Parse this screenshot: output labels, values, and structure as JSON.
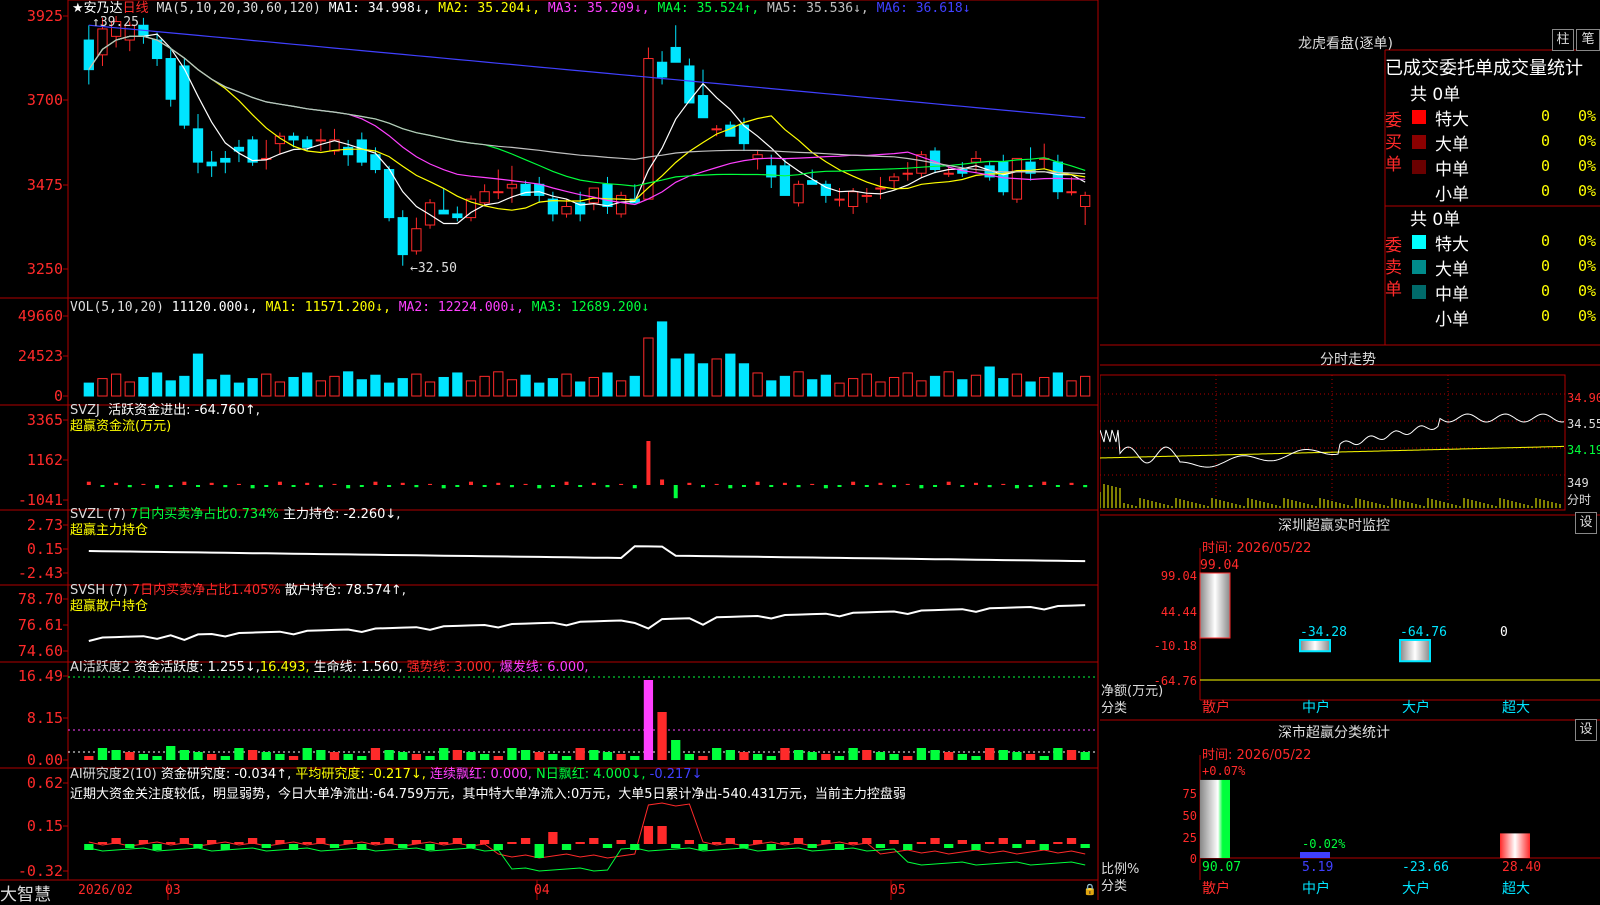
{
  "colors": {
    "up": "#ff2a2a",
    "down": "#00e5ff",
    "grid": "#c00000",
    "border": "#b00000",
    "yellow": "#ffff00",
    "white": "#ffffff",
    "green": "#00ff3c",
    "magenta": "#ff40ff",
    "blue": "#4040ff",
    "gray": "#c0c0c0"
  },
  "main": {
    "title": "★安乃达",
    "period": "日线",
    "ma_label": "MA(5,10,20,30,60,120)",
    "ma1": "MA1: 34.998↓,",
    "ma2": "MA2: 35.204↓,",
    "ma3": "MA3: 35.209↓,",
    "ma4": "MA4: 35.524↑,",
    "ma5": "MA5: 35.536↓,",
    "ma6": "MA6: 36.618↓",
    "high_mark": "39.25",
    "low_mark": "←32.50",
    "yticks": [
      "3925",
      "3700",
      "3475",
      "3250"
    ]
  },
  "vol": {
    "label": "VOL(5,10,20)",
    "val": "11120.000↓,",
    "ma1": "MA1: 11571.200↓,",
    "ma2": "MA2: 12224.000↓,",
    "ma3": "MA3: 12689.200↓",
    "yticks": [
      "49660",
      "24523",
      "0"
    ]
  },
  "svzj": {
    "label": "SVZJ",
    "t1": "活跃资金进出: -64.760↑,",
    "t2": "超赢资金流(万元)",
    "yticks": [
      "3365",
      "1162",
      "-1041"
    ]
  },
  "svzl": {
    "label": "SVZL (7)",
    "t1": "7日内买卖净占比0.734%",
    "t2": "主力持仓: -2.260↓,",
    "t3": "超赢主力持仓",
    "yticks": [
      "2.73",
      "0.15",
      "-2.43"
    ]
  },
  "svsh": {
    "label": "SVSH (7)",
    "t1": "7日内买卖净占比1.405%",
    "t2": "散户持仓: 78.574↑,",
    "t3": "超赢散户持仓",
    "yticks": [
      "78.70",
      "76.61",
      "74.60"
    ]
  },
  "ai1": {
    "label": "AI活跃度2",
    "t1": "资金活跃度: 1.255↓,",
    "t2": "16.493,",
    "t3": "生命线: 1.560,",
    "t4": "强势线: 3.000,",
    "t5": "爆发线: 6.000,",
    "yticks": [
      "16.49",
      "8.15",
      "0.00"
    ]
  },
  "ai2": {
    "label": "AI研究度2(10)",
    "t1": "资金研究度: -0.034↑,",
    "t2": "平均研究度: -0.217↓,",
    "t3": "连续飘红: 0.000,",
    "t4": "N日飘红: 4.000↓,",
    "t5": "-0.217↓",
    "comment": "近期大资金关注度较低，明显弱势，今日大单净流出:-64.759万元，其中特大单净流入:0万元，大单5日累计净出-540.431万元，当前主力控盘弱",
    "yticks": [
      "0.62",
      "0.15",
      "-0.32"
    ]
  },
  "xaxis": {
    "brand": "大智慧",
    "labels": [
      "2026/02",
      "03",
      "04",
      "05"
    ]
  },
  "dragon": {
    "title": "龙虎看盘(逐单)",
    "btn1": "柱",
    "btn2": "笔",
    "subtitle": "已成交委托单成交量统计",
    "buy_label": "委买单",
    "sell_label": "委卖单",
    "buy_total": "共 0单",
    "sell_total": "共 0单",
    "buy_rows": [
      {
        "name": "特大",
        "val": "0",
        "pct": "0%",
        "color": "#ff0000"
      },
      {
        "name": "大单",
        "val": "0",
        "pct": "0%",
        "color": "#8b0000"
      },
      {
        "name": "中单",
        "val": "0",
        "pct": "0%",
        "color": "#6a0000"
      },
      {
        "name": "小单",
        "val": "0",
        "pct": "0%",
        "color": ""
      }
    ],
    "sell_rows": [
      {
        "name": "特大",
        "val": "0",
        "pct": "0%",
        "color": "#00ffff"
      },
      {
        "name": "大单",
        "val": "0",
        "pct": "0%",
        "color": "#008b8b"
      },
      {
        "name": "中单",
        "val": "0",
        "pct": "0%",
        "color": "#006a6a"
      },
      {
        "name": "小单",
        "val": "0",
        "pct": "0%",
        "color": ""
      }
    ]
  },
  "intraday": {
    "title": "分时走势",
    "yticks": [
      "34.90",
      "34.55",
      "34.19"
    ],
    "vol_tick": "349",
    "unit": "分时"
  },
  "sz_monitor": {
    "title": "深圳超赢实时监控",
    "btn": "设",
    "date": "时间: 2026/05/22",
    "yticks": [
      "99.04",
      "44.44",
      "-10.18",
      "-64.76"
    ],
    "unit1": "净额(万元)",
    "unit2": "分类",
    "cats": [
      "散户",
      "中户",
      "大户",
      "超大"
    ],
    "values": [
      99.04,
      -34.28,
      -64.76,
      0
    ],
    "labels": [
      "99.04",
      "-34.28",
      "-64.76",
      "0"
    ]
  },
  "sz_stats": {
    "title": "深市超赢分类统计",
    "btn": "设",
    "date": "时间: 2026/05/22",
    "yticks": [
      "75",
      "50",
      "25",
      "0"
    ],
    "unit1": "比例%",
    "unit2": "分类",
    "cats": [
      "散户",
      "中户",
      "大户",
      "超大"
    ],
    "values": [
      90.07,
      5.19,
      -23.66,
      28.4
    ],
    "labels": [
      "90.07",
      "5.19",
      "-23.66",
      "28.40"
    ],
    "top_labels": [
      "+0.07%",
      "-0.02%"
    ]
  },
  "chart_data": [
    {
      "type": "candlestick",
      "title": "安乃达 日线",
      "note": "price values in yuan",
      "ohlc": [
        [
          38.6,
          39.0,
          37.4,
          37.8
        ],
        [
          38.2,
          39.2,
          37.9,
          38.9
        ],
        [
          38.7,
          39.25,
          38.4,
          39.1
        ],
        [
          38.6,
          39.1,
          38.3,
          39.0
        ],
        [
          39.0,
          39.2,
          38.5,
          38.7
        ],
        [
          38.6,
          38.8,
          37.9,
          38.1
        ],
        [
          38.1,
          38.4,
          36.8,
          37.0
        ],
        [
          37.9,
          38.1,
          36.2,
          36.3
        ],
        [
          36.2,
          36.6,
          35.0,
          35.3
        ],
        [
          35.3,
          35.6,
          34.9,
          35.2
        ],
        [
          35.4,
          35.6,
          35.0,
          35.3
        ],
        [
          35.7,
          35.9,
          35.3,
          35.6
        ],
        [
          35.9,
          36.0,
          35.2,
          35.3
        ],
        [
          35.4,
          35.9,
          35.1,
          35.4
        ],
        [
          35.8,
          36.1,
          35.5,
          36.0
        ],
        [
          36.0,
          36.1,
          35.7,
          35.9
        ],
        [
          35.9,
          36.0,
          35.6,
          35.7
        ],
        [
          35.9,
          36.2,
          35.6,
          35.9
        ],
        [
          35.6,
          36.2,
          35.5,
          35.9
        ],
        [
          35.7,
          35.9,
          35.2,
          35.5
        ],
        [
          35.9,
          36.1,
          35.2,
          35.3
        ],
        [
          35.5,
          35.7,
          35.0,
          35.1
        ],
        [
          35.1,
          35.2,
          33.7,
          33.8
        ],
        [
          33.8,
          34.0,
          32.5,
          32.8
        ],
        [
          32.9,
          33.8,
          32.8,
          33.5
        ],
        [
          33.6,
          34.3,
          33.5,
          34.2
        ],
        [
          34.0,
          34.6,
          33.9,
          33.9
        ],
        [
          33.9,
          34.1,
          33.7,
          33.8
        ],
        [
          33.8,
          34.4,
          33.7,
          34.3
        ],
        [
          34.2,
          34.7,
          34.1,
          34.5
        ],
        [
          34.5,
          35.1,
          34.3,
          34.5
        ],
        [
          34.6,
          35.2,
          34.2,
          34.7
        ],
        [
          34.7,
          34.8,
          34.4,
          34.4
        ],
        [
          34.7,
          34.9,
          34.2,
          34.4
        ],
        [
          34.3,
          34.5,
          33.7,
          33.9
        ],
        [
          33.9,
          34.3,
          33.8,
          34.1
        ],
        [
          34.2,
          34.5,
          33.7,
          33.9
        ],
        [
          34.2,
          34.6,
          34.0,
          34.6
        ],
        [
          34.7,
          34.9,
          33.9,
          34.1
        ],
        [
          33.9,
          34.5,
          33.8,
          34.4
        ],
        [
          34.3,
          34.7,
          34.2,
          34.2
        ],
        [
          34.3,
          38.4,
          34.3,
          38.1
        ],
        [
          38.0,
          38.3,
          37.4,
          37.6
        ],
        [
          38.4,
          39.0,
          38.1,
          38.0
        ],
        [
          37.9,
          38.1,
          36.9,
          36.9
        ],
        [
          37.1,
          37.8,
          36.5,
          36.5
        ],
        [
          36.2,
          36.3,
          36.0,
          36.2
        ],
        [
          36.3,
          36.4,
          36.1,
          36.0
        ],
        [
          36.3,
          36.5,
          35.6,
          35.8
        ],
        [
          35.4,
          35.6,
          35.1,
          35.5
        ],
        [
          35.2,
          35.5,
          34.6,
          34.9
        ],
        [
          35.2,
          35.4,
          34.4,
          34.4
        ],
        [
          34.2,
          34.8,
          34.1,
          34.7
        ],
        [
          34.8,
          35.1,
          34.7,
          34.7
        ],
        [
          34.7,
          34.8,
          34.2,
          34.4
        ],
        [
          34.3,
          34.6,
          34.1,
          34.3
        ],
        [
          34.1,
          34.6,
          33.9,
          34.5
        ],
        [
          34.4,
          34.6,
          34.2,
          34.4
        ],
        [
          34.6,
          34.9,
          34.3,
          34.6
        ],
        [
          34.8,
          35.0,
          34.6,
          34.9
        ],
        [
          35.0,
          35.3,
          34.8,
          35.0
        ],
        [
          35.0,
          35.6,
          34.9,
          35.5
        ],
        [
          35.6,
          35.7,
          35.0,
          35.1
        ],
        [
          35.0,
          35.2,
          34.9,
          35.0
        ],
        [
          35.1,
          35.3,
          34.9,
          35.0
        ],
        [
          35.3,
          35.6,
          35.0,
          35.4
        ],
        [
          35.2,
          35.3,
          34.8,
          34.9
        ],
        [
          35.3,
          35.5,
          34.4,
          34.5
        ],
        [
          34.3,
          35.4,
          34.2,
          35.4
        ],
        [
          35.3,
          35.7,
          34.8,
          35.0
        ],
        [
          35.4,
          35.8,
          35.1,
          35.4
        ],
        [
          35.3,
          35.5,
          34.3,
          34.5
        ],
        [
          34.5,
          34.9,
          34.4,
          34.5
        ],
        [
          34.1,
          34.5,
          33.6,
          34.4
        ]
      ],
      "ma": {
        "MA1": "white",
        "MA2": "yellow",
        "MA3": "magenta",
        "MA4": "green",
        "MA5": "gray",
        "MA6": "blue"
      }
    }
  ]
}
